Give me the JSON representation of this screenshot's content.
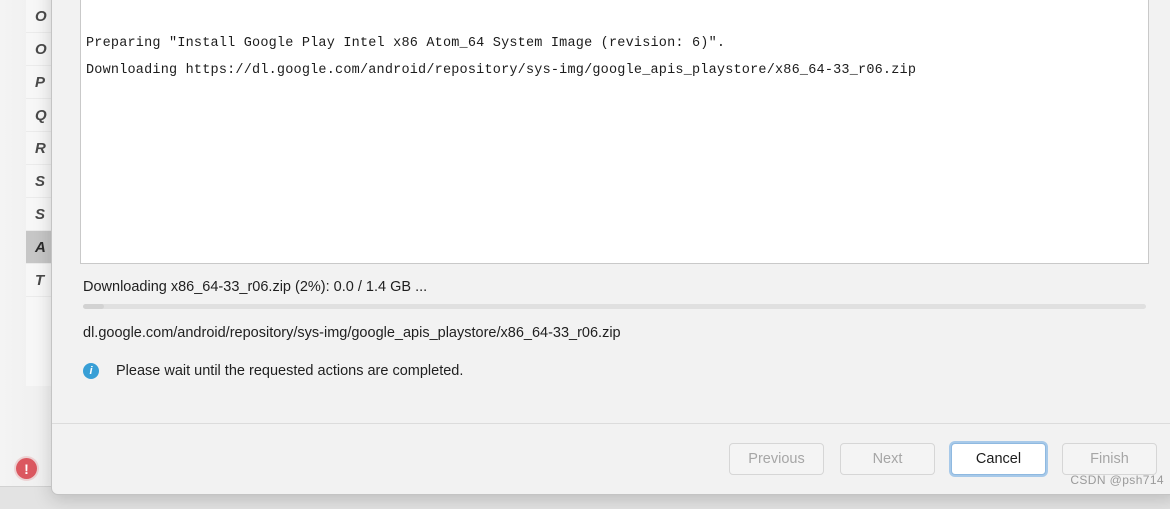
{
  "background": {
    "sidebar": {
      "items": [
        {
          "label": "O",
          "selected": false
        },
        {
          "label": "O",
          "selected": false
        },
        {
          "label": "P",
          "selected": false
        },
        {
          "label": "Q",
          "selected": false
        },
        {
          "label": "R",
          "selected": false
        },
        {
          "label": "S",
          "selected": false
        },
        {
          "label": "S",
          "selected": false
        },
        {
          "label": "A",
          "selected": true
        },
        {
          "label": "T",
          "selected": false
        }
      ]
    },
    "error_badge": {
      "icon": "error-exclamation-icon",
      "glyph": "!",
      "color": "#db5860"
    }
  },
  "dialog": {
    "console": {
      "lines": [
        "Preparing \"Install Google Play Intel x86 Atom_64 System Image (revision: 6)\".",
        "Downloading https://dl.google.com/android/repository/sys-img/google_apis_playstore/x86_64-33_r06.zip"
      ]
    },
    "status": {
      "text": "Downloading x86_64-33_r06.zip (2%): 0.0 / 1.4 GB ...",
      "percent": 2,
      "downloaded": "0.0",
      "total": "1.4 GB"
    },
    "progress_detail": "dl.google.com/android/repository/sys-img/google_apis_playstore/x86_64-33_r06.zip",
    "notice": {
      "icon": "info-icon",
      "glyph": "i",
      "color": "#389fd6",
      "text": "Please wait until the requested actions are completed."
    },
    "buttons": {
      "previous": {
        "label": "Previous",
        "state": "disabled"
      },
      "next": {
        "label": "Next",
        "state": "disabled"
      },
      "cancel": {
        "label": "Cancel",
        "state": "focused"
      },
      "finish": {
        "label": "Finish",
        "state": "disabled"
      }
    }
  },
  "watermark": "CSDN @psh714"
}
